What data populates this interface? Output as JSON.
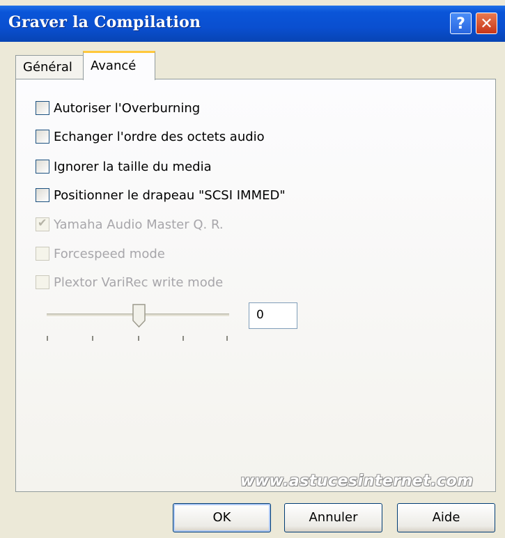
{
  "window": {
    "title": "Graver la Compilation",
    "help_glyph": "?",
    "close_glyph": "✕"
  },
  "tabs": [
    {
      "label": "Général"
    },
    {
      "label": "Avancé"
    }
  ],
  "options": [
    {
      "label": "Autoriser l'Overburning",
      "checked": false,
      "enabled": true
    },
    {
      "label": "Echanger l'ordre des octets audio",
      "checked": false,
      "enabled": true
    },
    {
      "label": "Ignorer la taille du media",
      "checked": false,
      "enabled": true
    },
    {
      "label": "Positionner le drapeau \"SCSI IMMED\"",
      "checked": false,
      "enabled": true
    },
    {
      "label": "Yamaha Audio Master Q. R.",
      "checked": true,
      "enabled": false
    },
    {
      "label": "Forcespeed mode",
      "checked": false,
      "enabled": false
    },
    {
      "label": "Plextor VariRec write mode",
      "checked": false,
      "enabled": false
    }
  ],
  "varirec": {
    "value": "0",
    "slider_level": 0.5
  },
  "watermark": "www.astucesinternet.com",
  "buttons": {
    "ok": "OK",
    "cancel": "Annuler",
    "help": "Aide"
  }
}
